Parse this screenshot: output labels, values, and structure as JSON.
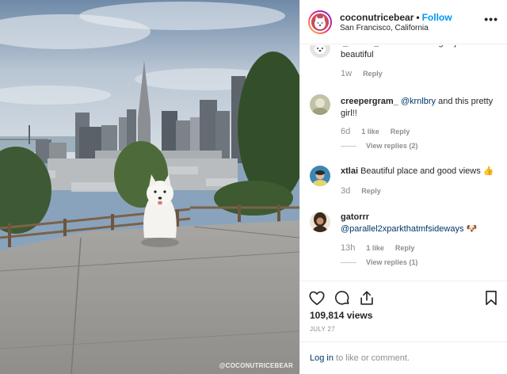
{
  "post": {
    "username": "coconutricebear",
    "separator": "•",
    "follow_label": "Follow",
    "location": "San Francisco, California",
    "more_label": "•••",
    "watermark": "@COCONUTRICEBEAR"
  },
  "comments": [
    {
      "username": "l_laroco_lr",
      "text": "Damn this dog is just so beautiful",
      "time": "1w",
      "likes": "",
      "reply_label": "Reply",
      "view_replies": ""
    },
    {
      "username": "creepergram_",
      "mention": "@krnlbry",
      "text": "and this pretty girl!!",
      "time": "6d",
      "likes": "1 like",
      "reply_label": "Reply",
      "view_replies": "View replies (2)"
    },
    {
      "username": "xtlai",
      "text": "Beautiful place and good views 👍",
      "time": "3d",
      "likes": "",
      "reply_label": "Reply",
      "view_replies": ""
    },
    {
      "username": "gatorrr",
      "mention": "@parallel2xparkthatmfsideways",
      "text": "🐶",
      "time": "13h",
      "likes": "1 like",
      "reply_label": "Reply",
      "view_replies": "View replies (1)"
    }
  ],
  "actions": {
    "like_icon": "heart-icon",
    "comment_icon": "comment-icon",
    "share_icon": "share-icon",
    "save_icon": "bookmark-icon",
    "views": "109,814 views",
    "date": "JULY 27"
  },
  "footer": {
    "login_label": "Log in",
    "login_suffix": "to like or comment."
  },
  "colors": {
    "accent": "#0095f6",
    "mention": "#00376b",
    "muted": "#8e8e8e",
    "text": "#262626"
  }
}
